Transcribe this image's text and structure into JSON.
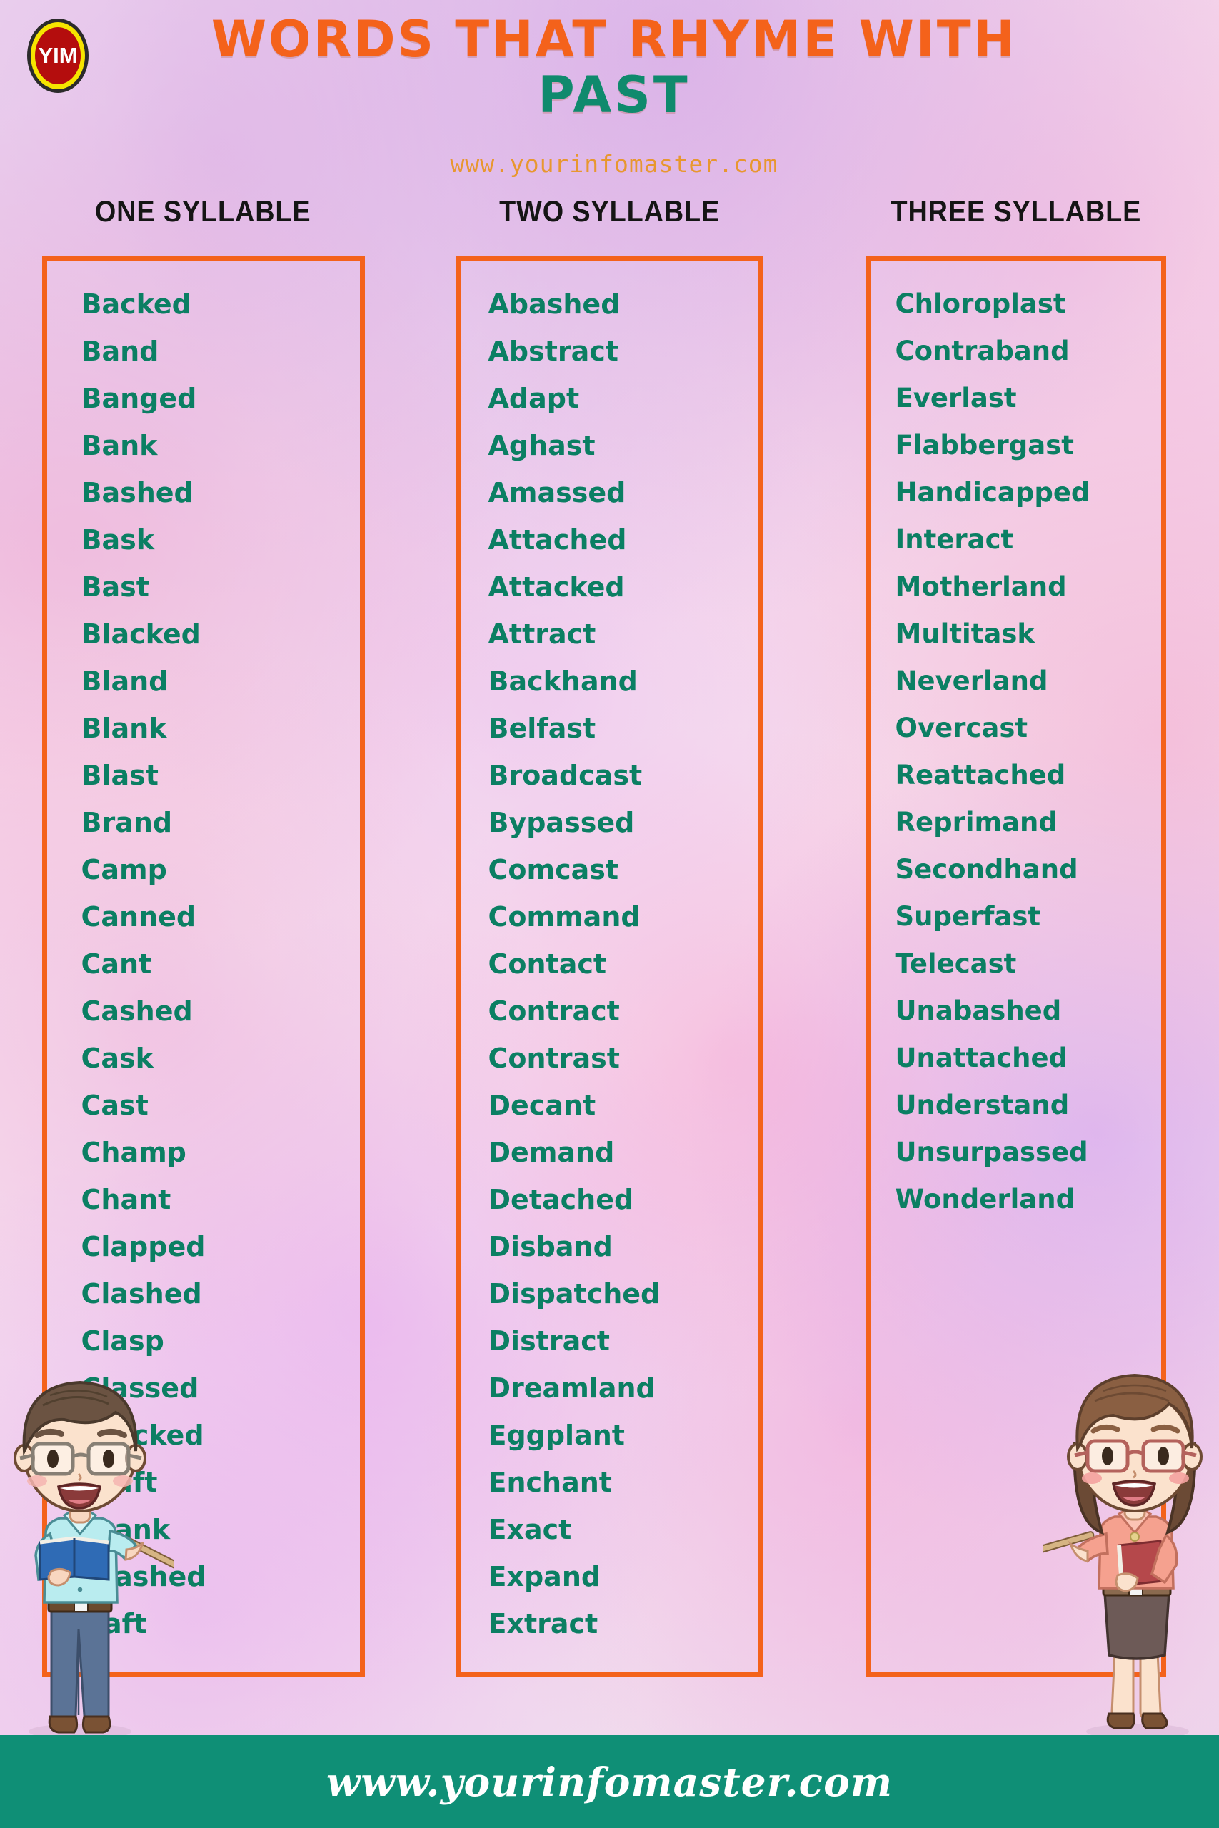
{
  "brand": {
    "logo_text": "YIM",
    "logo_ring_color": "#f6e400",
    "logo_disc_color": "#b40d0d"
  },
  "header": {
    "title_line1": "WORDS THAT RHYME WITH",
    "title_line2": "PAST",
    "title_color": "#f4621b",
    "keyword_color": "#0f8a6d",
    "site_url": "www.yourinfomaster.com"
  },
  "columns": [
    {
      "heading": "ONE SYLLABLE",
      "words": [
        "Backed",
        "Band",
        "Banged",
        "Bank",
        "Bashed",
        "Bask",
        "Bast",
        "Blacked",
        "Bland",
        "Blank",
        "Blast",
        "Brand",
        "Camp",
        "Canned",
        "Cant",
        "Cashed",
        "Cask",
        "Cast",
        "Champ",
        "Chant",
        "Clapped",
        "Clashed",
        "Clasp",
        "Classed",
        "Cracked",
        "Craft",
        "Crank",
        "Crashed",
        "Daft"
      ]
    },
    {
      "heading": "TWO SYLLABLE",
      "words": [
        "Abashed",
        "Abstract",
        "Adapt",
        "Aghast",
        "Amassed",
        "Attached",
        "Attacked",
        "Attract",
        "Backhand",
        "Belfast",
        "Broadcast",
        "Bypassed",
        "Comcast",
        "Command",
        "Contact",
        "Contract",
        "Contrast",
        "Decant",
        "Demand",
        "Detached",
        "Disband",
        "Dispatched",
        "Distract",
        "Dreamland",
        "Eggplant",
        "Enchant",
        "Exact",
        "Expand",
        "Extract"
      ]
    },
    {
      "heading": "THREE SYLLABLE",
      "words": [
        "Chloroplast",
        "Contraband",
        "Everlast",
        "Flabbergast",
        "Handicapped",
        "Interact",
        "Motherland",
        "Multitask",
        "Neverland",
        "Overcast",
        "Reattached",
        "Reprimand",
        "Secondhand",
        "Superfast",
        "Telecast",
        "Unabashed",
        "Unattached",
        "Understand",
        "Unsurpassed",
        "Wonderland"
      ]
    }
  ],
  "footer": {
    "site_url": "www.yourinfomaster.com",
    "bar_color": "#0f8f76"
  },
  "illustrations": {
    "left": "male-teacher-with-book-and-pointer",
    "right": "female-teacher-with-book-and-pointer"
  },
  "theme": {
    "word_color": "#0b7f63",
    "border_color": "#f4621b",
    "heading_color": "#151515"
  }
}
